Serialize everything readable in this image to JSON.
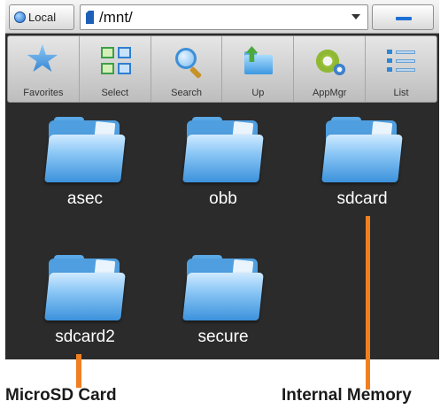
{
  "pathbar": {
    "location_label": "Local",
    "current_path": "/mnt/"
  },
  "toolbar": {
    "items": [
      {
        "label": "Favorites",
        "icon": "star-icon"
      },
      {
        "label": "Select",
        "icon": "select-grid-icon"
      },
      {
        "label": "Search",
        "icon": "magnifier-icon"
      },
      {
        "label": "Up",
        "icon": "folder-up-icon"
      },
      {
        "label": "AppMgr",
        "icon": "gear-icon"
      },
      {
        "label": "List",
        "icon": "list-view-icon"
      }
    ]
  },
  "folders": [
    {
      "name": "asec"
    },
    {
      "name": "obb"
    },
    {
      "name": "sdcard"
    },
    {
      "name": "sdcard2"
    },
    {
      "name": "secure"
    }
  ],
  "annotations": {
    "microsd": "MicroSD Card",
    "internal": "Internal Memory"
  },
  "colors": {
    "background": "#2b2b2b",
    "accent": "#1d6fd6",
    "annotation_marker": "#f17f20"
  }
}
